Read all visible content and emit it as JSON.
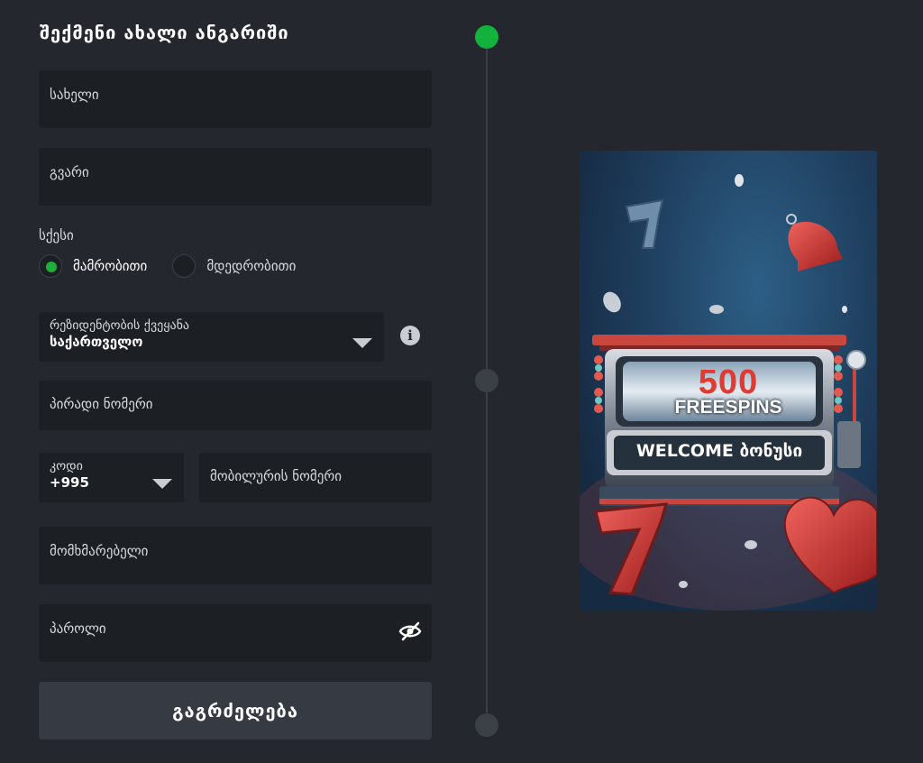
{
  "title": "შექმენი ახალი ანგარიში",
  "fields": {
    "first_name": "სახელი",
    "last_name": "გვარი",
    "personal_number": "პირადი ნომერი",
    "mobile": "მობილურის ნომერი",
    "username": "მომხმარებელი",
    "password": "პაროლი"
  },
  "gender": {
    "label": "სქესი",
    "options": [
      "მამრობითი",
      "მდედრობითი"
    ],
    "selected": "მამრობითი"
  },
  "residence": {
    "label": "რეზიდენტობის ქვეყანა",
    "value": "საქართველო"
  },
  "phone_code": {
    "label": "კოდი",
    "value": "+995"
  },
  "continue_label": "გაგრძელება",
  "steps": {
    "total": 3,
    "current": 1
  },
  "promo": {
    "line1": "500",
    "line2": "FREESPINS",
    "line3": "WELCOME ბონუსი"
  },
  "colors": {
    "background": "#24272d",
    "field": "#1c1f24",
    "accent_green": "#13b23c",
    "button": "#363a42"
  },
  "icons": [
    "info-icon",
    "eye-off-icon",
    "chevron-down-icon"
  ]
}
